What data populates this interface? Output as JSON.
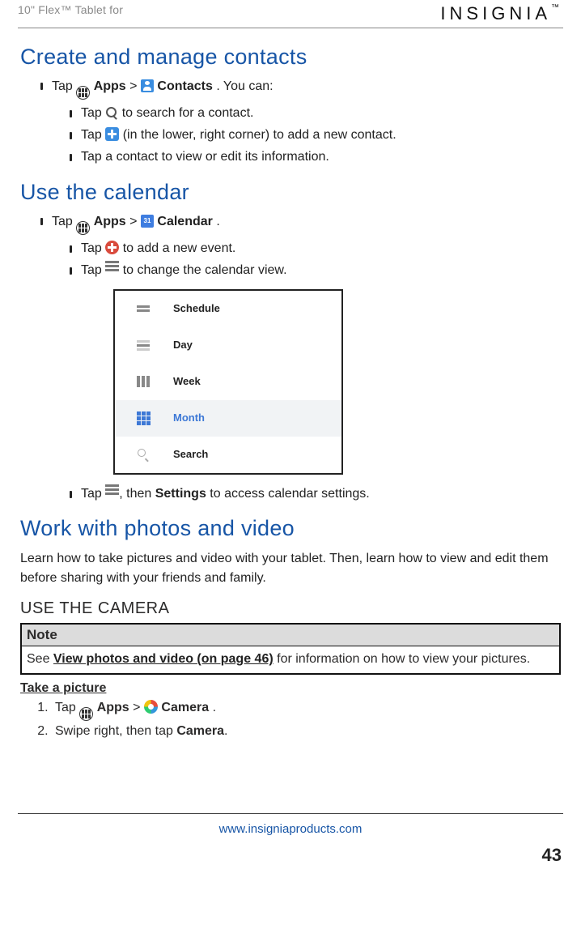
{
  "header": {
    "product_name": "10\" Flex™ Tablet for",
    "brand": "INSIGNIA"
  },
  "sections": {
    "contacts": {
      "title": "Create and manage contacts",
      "line1_a": "Tap ",
      "line1_b": " Apps",
      "line1_c": " > ",
      "line1_d": " Contacts",
      "line1_e": ". You can:",
      "s1": "Tap ",
      "s1_b": " to search for a contact.",
      "s2": "Tap ",
      "s2_b": " (in the lower, right corner) to add a new contact.",
      "s3": "Tap a contact to view or edit its information."
    },
    "calendar": {
      "title": "Use the calendar",
      "line1_a": "Tap ",
      "line1_b": " Apps",
      "line1_c": " > ",
      "line1_d": " Calendar",
      "line1_e": ".",
      "s1": "Tap ",
      "s1_b": " to add a new event.",
      "s2": "Tap ",
      "s2_b": " to change the calendar view.",
      "s3": "Tap ",
      "s3_mid": ", then ",
      "s3_bold": "Settings",
      "s3_end": " to access calendar settings.",
      "views": [
        "Schedule",
        "Day",
        "Week",
        "Month",
        "Search"
      ]
    },
    "photos": {
      "title": "Work with photos and video",
      "intro": "Learn how to take pictures and video with your tablet. Then, learn how to view and edit them before sharing with your friends and family.",
      "use_camera": "USE THE CAMERA",
      "note_title": "Note",
      "note_pre": "See ",
      "note_link": "View photos and video (on page 46)",
      "note_post": " for information on how to view your pictures.",
      "take_title": "Take a picture",
      "step1_a": "Tap ",
      "step1_b": " Apps",
      "step1_c": " > ",
      "step1_d": " Camera",
      "step1_e": ".",
      "step2_a": "Swipe right, then tap ",
      "step2_b": "Camera",
      "step2_c": "."
    }
  },
  "footer": {
    "url": "www.insigniaproducts.com",
    "page_number": "43"
  }
}
